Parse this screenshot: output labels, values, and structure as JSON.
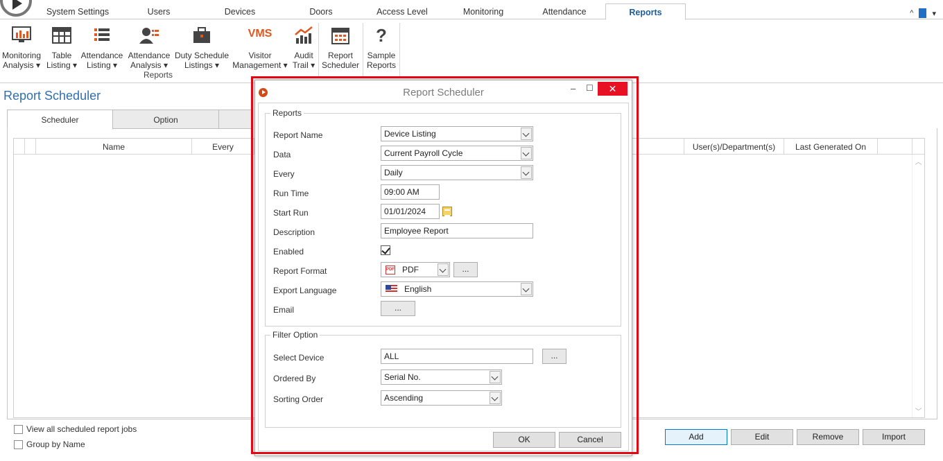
{
  "menu": {
    "tabs": [
      "System Settings",
      "Users",
      "Devices",
      "Doors",
      "Access Level",
      "Monitoring",
      "Attendance",
      "Reports"
    ],
    "active": "Reports",
    "right_caret": "^"
  },
  "ribbon": {
    "buttons": [
      {
        "line1": "Monitoring",
        "line2": "Analysis ▾"
      },
      {
        "line1": "Table",
        "line2": "Listing ▾"
      },
      {
        "line1": "Attendance",
        "line2": "Listing ▾"
      },
      {
        "line1": "Attendance",
        "line2": "Analysis ▾"
      },
      {
        "line1": "Duty Schedule",
        "line2": "Listings ▾"
      },
      {
        "line1": "Visitor",
        "line2": "Management ▾"
      },
      {
        "line1": "Audit",
        "line2": "Trail ▾"
      },
      {
        "line1": "Report",
        "line2": "Scheduler"
      },
      {
        "line1": "Sample",
        "line2": "Reports"
      }
    ],
    "vms_text": "VMS",
    "help_glyph": "?",
    "group_label": "Reports"
  },
  "page": {
    "title": "Report Scheduler",
    "tabs": [
      "Scheduler",
      "Option"
    ],
    "grid_columns": [
      "Name",
      "Every",
      "User(s)/Department(s)",
      "Last Generated On"
    ],
    "view_all_label": "View all scheduled report jobs",
    "group_by_label": "Group by Name",
    "buttons": {
      "add": "Add",
      "edit": "Edit",
      "remove": "Remove",
      "import": "Import"
    }
  },
  "dialog": {
    "title": "Report Scheduler",
    "reports_legend": "Reports",
    "fields": {
      "report_name_label": "Report Name",
      "report_name_value": "Device Listing",
      "data_label": "Data",
      "data_value": "Current Payroll Cycle",
      "every_label": "Every",
      "every_value": "Daily",
      "run_time_label": "Run Time",
      "run_time_value": "09:00 AM",
      "start_run_label": "Start Run",
      "start_run_value": "01/01/2024",
      "description_label": "Description",
      "description_value": "Employee Report",
      "enabled_label": "Enabled",
      "enabled": true,
      "report_format_label": "Report Format",
      "report_format_value": "PDF",
      "pdf_icon_text": "PDF",
      "export_language_label": "Export Language",
      "export_language_value": "English",
      "email_label": "Email",
      "ellipsis": "..."
    },
    "filter_legend": "Filter Option",
    "filter": {
      "select_device_label": "Select Device",
      "select_device_value": "ALL",
      "ordered_by_label": "Ordered By",
      "ordered_by_value": "Serial No.",
      "sorting_order_label": "Sorting Order",
      "sorting_order_value": "Ascending"
    },
    "ok_label": "OK",
    "cancel_label": "Cancel",
    "close_glyph": "✕",
    "minimize_glyph": "–",
    "maximize_glyph": "☐"
  }
}
